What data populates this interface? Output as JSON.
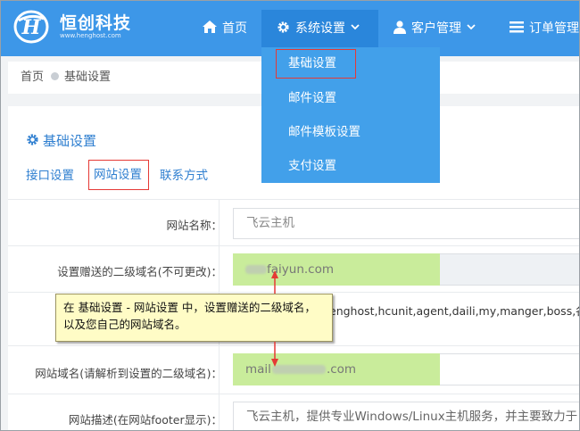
{
  "brand": {
    "name": "恒创科技",
    "url": "www.henghost.com"
  },
  "nav": {
    "home": "首页",
    "system": "系统设置",
    "customer": "客户管理",
    "order": "订单管理"
  },
  "dropdown": {
    "items": [
      "基础设置",
      "邮件设置",
      "邮件模板设置",
      "支付设置"
    ]
  },
  "breadcrumb": {
    "home": "首页",
    "current": "基础设置"
  },
  "page": {
    "title": "基础设置",
    "tabs": [
      "接口设置",
      "网站设置",
      "联系方式"
    ]
  },
  "form": {
    "site_name_label": "网站名称：",
    "site_name_placeholder": "飞云主机",
    "subdomain_label": "设置赠送的二级域名(不可更改)：",
    "subdomain_value": "faiyun.com",
    "subdomain_hint": "enghost,hcunit,agent,daili,my,manger,boss,各大",
    "domain_label": "网站域名(请解析到设置的二级域名)：",
    "domain_prefix": "mail",
    "domain_suffix": ".com",
    "desc_label": "网站描述(在网站footer显示)：",
    "desc_value": "飞云主机，提供专业Windows/Linux主机服务，并主要致力于"
  },
  "callout": {
    "text": "在 基础设置 - 网站设置 中，设置赠送的二级域名，以及您自己的网站域名。"
  },
  "colors": {
    "nav_bg": "#3d97e8",
    "nav_active": "#2a86db",
    "dropdown_bg": "#42a0ea",
    "accent": "#2f7fd0",
    "highlight": "#c9ec9b",
    "annotation_red": "#e53935",
    "callout_bg": "#fffcc6"
  }
}
